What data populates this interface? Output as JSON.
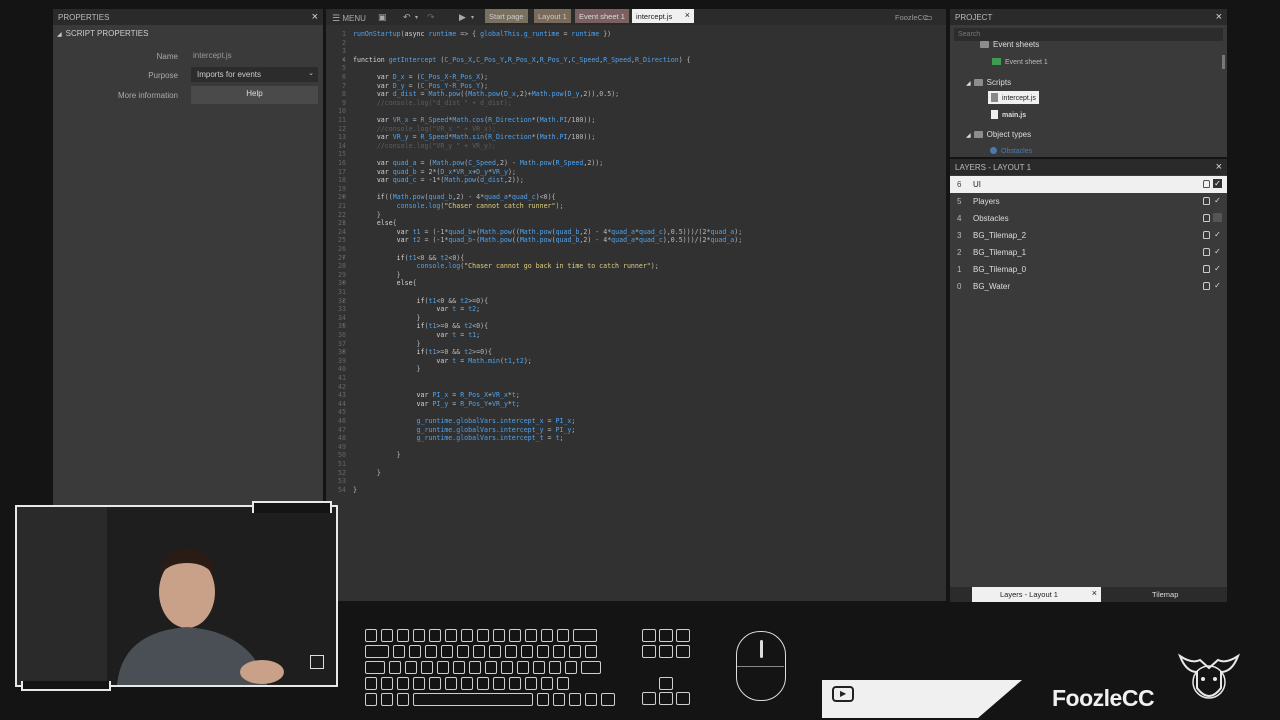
{
  "properties": {
    "header": "PROPERTIES",
    "section": "SCRIPT PROPERTIES",
    "rows": [
      {
        "label": "Name",
        "value": "intercept.js"
      },
      {
        "label": "Purpose",
        "value": "Imports for events"
      },
      {
        "label": "More information",
        "value": "Help"
      }
    ]
  },
  "toolbar": {
    "menu_label": "MENU",
    "tabs": [
      "Start page",
      "Layout 1",
      "Event sheet 1",
      "intercept.js"
    ],
    "brand": "FoozleCC",
    "active_tab_color": "#f0f0f0",
    "tab_color": "#7a7060"
  },
  "code_lines": [
    {
      "n": "1",
      "t": "runOnStartup(async runtime => { globalThis.g_runtime = runtime })"
    },
    {
      "n": "2",
      "t": ""
    },
    {
      "n": "3",
      "t": ""
    },
    {
      "n": "4",
      "t": "function getIntercept (C_Pos_X,C_Pos_Y,R_Pos_X,R_Pos_Y,C_Speed,R_Speed,R_Direction) {"
    },
    {
      "n": "5",
      "t": ""
    },
    {
      "n": "6",
      "t": "      var D_x = (C_Pos_X-R_Pos_X);"
    },
    {
      "n": "7",
      "t": "      var D_y = (C_Pos_Y-R_Pos_Y);"
    },
    {
      "n": "8",
      "t": "      var d_dist = Math.pow((Math.pow(D_x,2)+Math.pow(D_y,2)),0.5);"
    },
    {
      "n": "9",
      "t": "      //console.log(\"d_dist \" + d_dist);"
    },
    {
      "n": "10",
      "t": ""
    },
    {
      "n": "11",
      "t": "      var VR_x = R_Speed*Math.cos(R_Direction*(Math.PI/180));"
    },
    {
      "n": "12",
      "t": "      //console.log(\"VR_x \" + VR_x);"
    },
    {
      "n": "13",
      "t": "      var VR_y = R_Speed*Math.sin(R_Direction*(Math.PI/180));"
    },
    {
      "n": "14",
      "t": "      //console.log(\"VR_y \" + VR_y);"
    },
    {
      "n": "15",
      "t": ""
    },
    {
      "n": "16",
      "t": "      var quad_a = (Math.pow(C_Speed,2) - Math.pow(R_Speed,2));"
    },
    {
      "n": "17",
      "t": "      var quad_b = 2*(D_x*VR_x+D_y*VR_y);"
    },
    {
      "n": "18",
      "t": "      var quad_c = -1*(Math.pow(d_dist,2));"
    },
    {
      "n": "19",
      "t": ""
    },
    {
      "n": "20",
      "t": "      if((Math.pow(quad_b,2) - 4*quad_a*quad_c)<0){"
    },
    {
      "n": "21",
      "t": "           console.log(\"Chaser cannot catch runner\");"
    },
    {
      "n": "22",
      "t": "      }"
    },
    {
      "n": "23",
      "t": "      else{"
    },
    {
      "n": "24",
      "t": "           var t1 = (-1*quad_b+(Math.pow((Math.pow(quad_b,2) - 4*quad_a*quad_c),0.5)))/(2*quad_a);"
    },
    {
      "n": "25",
      "t": "           var t2 = (-1*quad_b-(Math.pow((Math.pow(quad_b,2) - 4*quad_a*quad_c),0.5)))/(2*quad_a);"
    },
    {
      "n": "26",
      "t": ""
    },
    {
      "n": "27",
      "t": "           if(t1<0 && t2<0){"
    },
    {
      "n": "28",
      "t": "                console.log(\"Chaser cannot go back in time to catch runner\");"
    },
    {
      "n": "29",
      "t": "           }"
    },
    {
      "n": "30",
      "t": "           else{"
    },
    {
      "n": "31",
      "t": ""
    },
    {
      "n": "32",
      "t": "                if(t1<0 && t2>=0){"
    },
    {
      "n": "33",
      "t": "                     var t = t2;"
    },
    {
      "n": "34",
      "t": "                }"
    },
    {
      "n": "35",
      "t": "                if(t1>=0 && t2<0){"
    },
    {
      "n": "36",
      "t": "                     var t = t1;"
    },
    {
      "n": "37",
      "t": "                }"
    },
    {
      "n": "38",
      "t": "                if(t1>=0 && t2>=0){"
    },
    {
      "n": "39",
      "t": "                     var t = Math.min(t1,t2);"
    },
    {
      "n": "40",
      "t": "                }"
    },
    {
      "n": "41",
      "t": ""
    },
    {
      "n": "42",
      "t": ""
    },
    {
      "n": "43",
      "t": "                var PI_x = R_Pos_X+VR_x*t;"
    },
    {
      "n": "44",
      "t": "                var PI_y = R_Pos_Y+VR_y*t;"
    },
    {
      "n": "45",
      "t": ""
    },
    {
      "n": "46",
      "t": "                g_runtime.globalVars.intercept_x = PI_x;"
    },
    {
      "n": "47",
      "t": "                g_runtime.globalVars.intercept_y = PI_y;"
    },
    {
      "n": "48",
      "t": "                g_runtime.globalVars.intercept_t = t;"
    },
    {
      "n": "49",
      "t": ""
    },
    {
      "n": "50",
      "t": "           }"
    },
    {
      "n": "51",
      "t": ""
    },
    {
      "n": "52",
      "t": "      }"
    },
    {
      "n": "53",
      "t": ""
    },
    {
      "n": "54",
      "t": "}"
    }
  ],
  "project": {
    "header": "PROJECT",
    "search_placeholder": "Search",
    "tree": [
      {
        "label": "Event sheets",
        "icon": "folder-icon"
      },
      {
        "label": "Event sheet 1",
        "icon": "event-sheet-icon"
      },
      {
        "label": "Scripts",
        "icon": "folder-icon"
      },
      {
        "label": "intercept.js",
        "icon": "script-file-icon"
      },
      {
        "label": "main.js",
        "icon": "script-file-icon"
      },
      {
        "label": "Object types",
        "icon": "folder-icon"
      },
      {
        "label": "Obstacles",
        "icon": "object-icon"
      }
    ]
  },
  "layers": {
    "header": "LAYERS - LAYOUT 1",
    "rows": [
      {
        "index": "6",
        "name": "UI",
        "checked": true
      },
      {
        "index": "5",
        "name": "Players",
        "checked": true
      },
      {
        "index": "4",
        "name": "Obstacles",
        "checked": false
      },
      {
        "index": "3",
        "name": "BG_Tilemap_2",
        "checked": true
      },
      {
        "index": "2",
        "name": "BG_Tilemap_1",
        "checked": true
      },
      {
        "index": "1",
        "name": "BG_Tilemap_0",
        "checked": true
      },
      {
        "index": "0",
        "name": "BG_Water",
        "checked": true
      }
    ]
  },
  "bottom_tabs": [
    "Layers - Layout 1",
    "Tilemap"
  ],
  "overlay": {
    "youtube_label": "YOUTUBE",
    "brand": "FoozleCC",
    "bracket_icon": "corner-bracket-icon",
    "logo_icon": "bull-logo-icon"
  }
}
